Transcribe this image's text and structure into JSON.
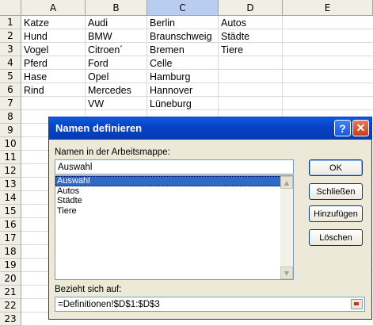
{
  "columns": [
    "A",
    "B",
    "C",
    "D",
    "E"
  ],
  "selected_column": "C",
  "rows": [
    "1",
    "2",
    "3",
    "4",
    "5",
    "6",
    "7",
    "8",
    "9",
    "10",
    "11",
    "12",
    "13",
    "14",
    "15",
    "16",
    "17",
    "18",
    "19",
    "20",
    "21",
    "22",
    "23"
  ],
  "cells": {
    "A": [
      "Katze",
      "Hund",
      "Vogel",
      "Pferd",
      "Hase",
      "Rind"
    ],
    "B": [
      "Audi",
      "BMW",
      "Citroen´",
      "Ford",
      "Opel",
      "Mercedes",
      "VW"
    ],
    "C": [
      "Berlin",
      "Braunschweig",
      "Bremen",
      "Celle",
      "Hamburg",
      "Hannover",
      "Lüneburg"
    ],
    "D": [
      "Autos",
      "Städte",
      "Tiere"
    ]
  },
  "dialog": {
    "title": "Namen definieren",
    "names_label": "Namen in der Arbeitsmappe:",
    "name_value": "Auswahl",
    "names_list": [
      "Auswahl",
      "Autos",
      "Städte",
      "Tiere"
    ],
    "refers_label": "Bezieht sich auf:",
    "refers_value": "=Definitionen!$D$1:$D$3",
    "buttons": {
      "ok": "OK",
      "close": "Schließen",
      "add": "Hinzufügen",
      "delete": "Löschen"
    },
    "help_glyph": "?",
    "close_glyph": "✕"
  },
  "colors": {
    "title_bar": "#0843c7",
    "selection": "#316ac5",
    "header_selected": "#b9cdf1",
    "dialog_bg": "#ece9d8"
  }
}
